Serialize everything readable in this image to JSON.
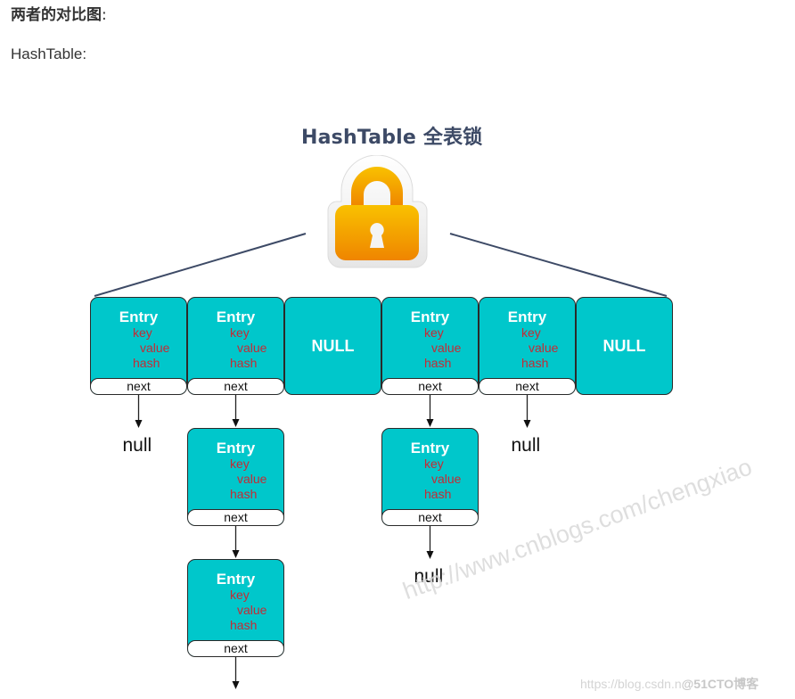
{
  "heading": "两者的对比图",
  "heading_colon": ":",
  "subheading": "HashTable:",
  "diagram": {
    "title": "HashTable 全表锁",
    "lock_icon": "padlock-icon",
    "colors": {
      "box_fill": "#00c7cb",
      "field_text": "#c42b35",
      "title_text": "#3d4a66",
      "lock_top": "#f9c100",
      "lock_bottom": "#ef8500",
      "wire": "#3d4a66"
    },
    "buckets": [
      {
        "type": "entry",
        "title": "Entry",
        "fields": [
          "key",
          "value",
          "hash"
        ],
        "next_label": "next"
      },
      {
        "type": "entry",
        "title": "Entry",
        "fields": [
          "key",
          "value",
          "hash"
        ],
        "next_label": "next"
      },
      {
        "type": "null",
        "title": "NULL"
      },
      {
        "type": "entry",
        "title": "Entry",
        "fields": [
          "key",
          "value",
          "hash"
        ],
        "next_label": "next"
      },
      {
        "type": "entry",
        "title": "Entry",
        "fields": [
          "key",
          "value",
          "hash"
        ],
        "next_label": "next"
      },
      {
        "type": "null",
        "title": "NULL"
      }
    ],
    "chains": [
      {
        "bucket": 1,
        "terminal": "null"
      },
      {
        "bucket": 2,
        "nodes": [
          {
            "title": "Entry",
            "fields": [
              "key",
              "value",
              "hash"
            ],
            "next_label": "next"
          },
          {
            "title": "Entry",
            "fields": [
              "key",
              "value",
              "hash"
            ],
            "next_label": "next"
          }
        ]
      },
      {
        "bucket": 4,
        "nodes": [
          {
            "title": "Entry",
            "fields": [
              "key",
              "value",
              "hash"
            ],
            "next_label": "next"
          }
        ],
        "terminal": "null"
      },
      {
        "bucket": 5,
        "terminal": "null"
      }
    ],
    "null_text": "null"
  },
  "watermarks": {
    "diagonal": "http://www.cnblogs.com/chengxiao",
    "footer_url": "https://blog.csdn.n",
    "footer_brand": "@51CTO博客"
  }
}
